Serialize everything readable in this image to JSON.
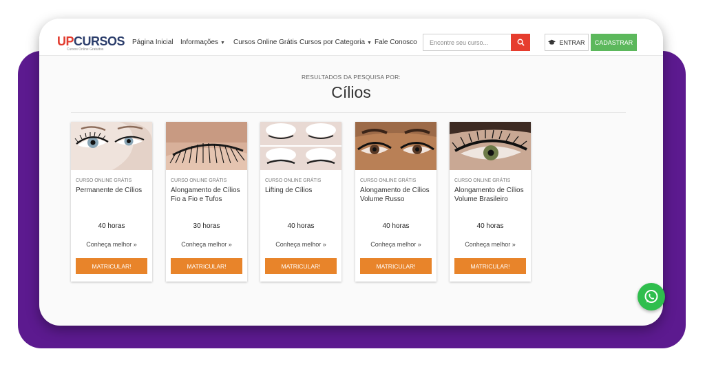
{
  "brand": {
    "up": "UP",
    "cursos": "CURSOS",
    "tagline": "Cursos Online Gratuitos",
    "up_color": "#e23b2e",
    "cursos_color": "#2b3d6b"
  },
  "nav": [
    {
      "label": "Página Inicial"
    },
    {
      "label": "Informações",
      "dropdown": true
    },
    {
      "label": "Cursos Online Grátis"
    },
    {
      "label": "Cursos por Categoria",
      "dropdown": true
    },
    {
      "label": "Fale Conosco"
    }
  ],
  "search": {
    "placeholder": "Encontre seu curso...",
    "icon": "search-icon"
  },
  "auth": {
    "login": "ENTRAR",
    "login_icon": "graduation-cap-icon",
    "signup": "CADASTRAR"
  },
  "results": {
    "label": "RESULTADOS DA PESQUISA POR:",
    "query": "Cílios"
  },
  "courses": [
    {
      "category": "CURSO ONLINE GRÁTIS",
      "title": "Permanente de Cílios",
      "hours": "40 horas",
      "link": "Conheça melhor »",
      "button": "MATRICULAR!"
    },
    {
      "category": "CURSO ONLINE GRÁTIS",
      "title": "Alongamento de Cílios Fio a Fio e Tufos",
      "hours": "30 horas",
      "link": "Conheça melhor »",
      "button": "MATRICULAR!"
    },
    {
      "category": "CURSO ONLINE GRÁTIS",
      "title": "Lifting de Cílios",
      "hours": "40 horas",
      "link": "Conheça melhor »",
      "button": "MATRICULAR!"
    },
    {
      "category": "CURSO ONLINE GRÁTIS",
      "title": "Alongamento de Cílios Volume Russo",
      "hours": "40 horas",
      "link": "Conheça melhor »",
      "button": "MATRICULAR!"
    },
    {
      "category": "CURSO ONLINE GRÁTIS",
      "title": "Alongamento de Cílios Volume Brasileiro",
      "hours": "40 horas",
      "link": "Conheça melhor »",
      "button": "MATRICULAR!"
    }
  ],
  "colors": {
    "accent_orange": "#e8842a",
    "signup_green": "#5cb85c",
    "search_red": "#e63d2e",
    "frame_purple": "#5c1a8f",
    "whatsapp_green": "#2fbe4d"
  },
  "floating": {
    "icon": "whatsapp-icon"
  }
}
